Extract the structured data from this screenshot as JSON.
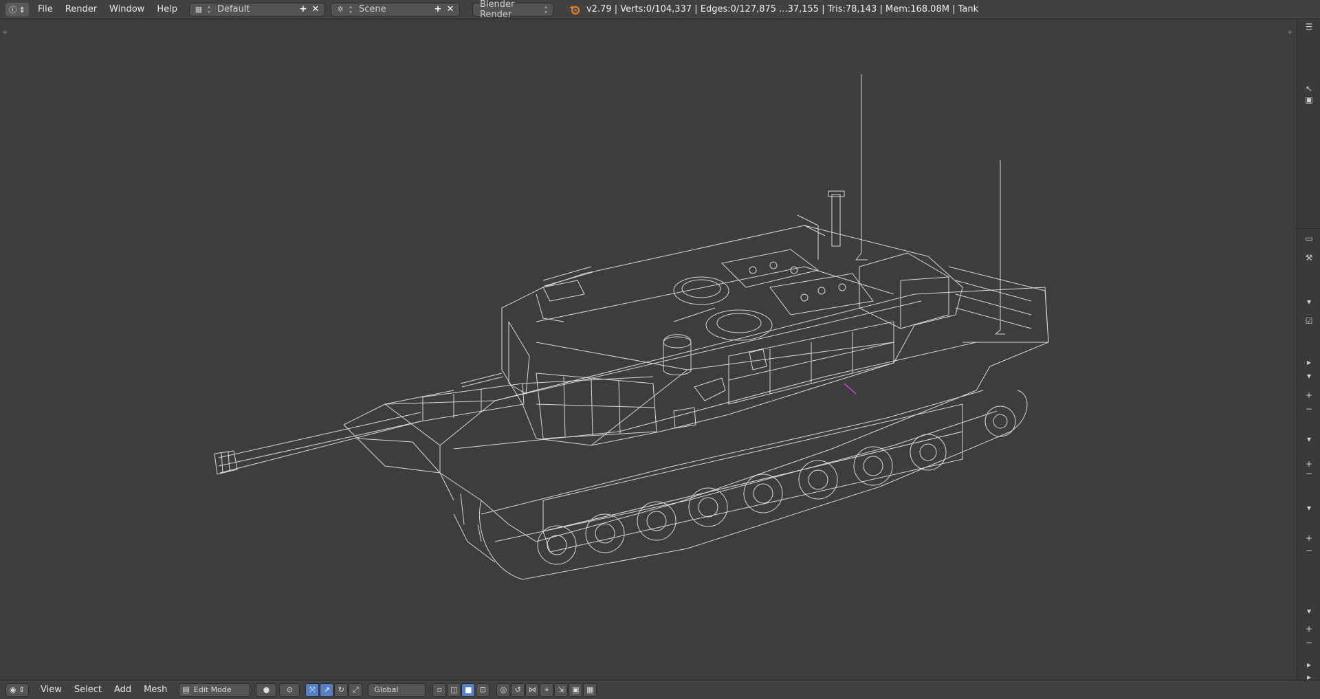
{
  "topbar": {
    "editor_icon": "info-icon",
    "menus": [
      "File",
      "Render",
      "Window",
      "Help"
    ],
    "layout": {
      "icon": "screen-layout-icon",
      "value": "Default"
    },
    "scene": {
      "icon": "scene-icon",
      "value": "Scene"
    },
    "render_engine": "Blender Render",
    "stats": "v2.79 | Verts:0/104,337 | Edges:0/127,875 ...37,155 | Tris:78,143 | Mem:168.08M | Tank"
  },
  "bottombar": {
    "editor_icon": "3d-view-icon",
    "menus": [
      "View",
      "Select",
      "Add",
      "Mesh"
    ],
    "mode": "Edit Mode",
    "orientation": "Global"
  },
  "colors": {
    "viewport_bg": "#3d3d3d",
    "wire": "#e8e8e8",
    "accent": "#5680c2",
    "selected_edge": "#e040e0"
  }
}
